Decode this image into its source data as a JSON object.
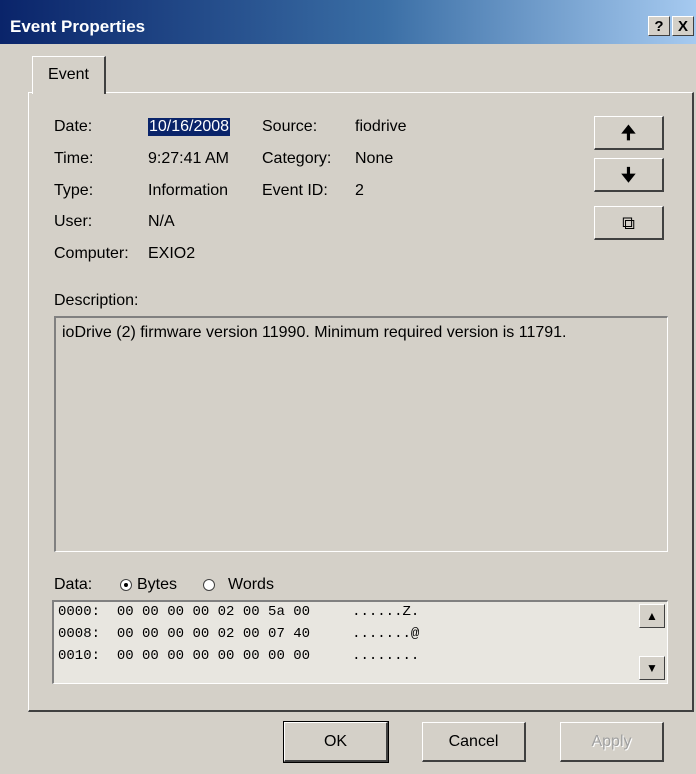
{
  "window": {
    "title": "Event Properties",
    "help_btn": "?",
    "close_btn": "X"
  },
  "tabs": [
    {
      "label": "Event"
    }
  ],
  "fields": {
    "date_label": "Date:",
    "date_value": "10/16/2008",
    "time_label": "Time:",
    "time_value": "9:27:41 AM",
    "type_label": "Type:",
    "type_value": "Information",
    "user_label": "User:",
    "user_value": "N/A",
    "computer_label": "Computer:",
    "computer_value": "EXIO2",
    "source_label": "Source:",
    "source_value": "fiodrive",
    "category_label": "Category:",
    "category_value": "None",
    "eventid_label": "Event ID:",
    "eventid_value": "2"
  },
  "nav": {
    "up_icon": "up-arrow-icon",
    "down_icon": "down-arrow-icon",
    "copy_icon": "copy-icon",
    "up": "🠉",
    "down": "🠋",
    "copy": "⧉"
  },
  "description": {
    "label": "Description:",
    "text": "ioDrive (2) firmware version 11990. Minimum required version is 11791."
  },
  "data": {
    "label": "Data:",
    "bytes_label": "Bytes",
    "words_label": "Words",
    "selected": "Bytes",
    "rows": [
      {
        "offset": "0000:",
        "hex": "00 00 00 00 02 00 5a 00",
        "ascii": "......Z."
      },
      {
        "offset": "0008:",
        "hex": "00 00 00 00 02 00 07 40",
        "ascii": ".......@"
      },
      {
        "offset": "0010:",
        "hex": "00 00 00 00 00 00 00 00",
        "ascii": "........"
      }
    ]
  },
  "buttons": {
    "ok": "OK",
    "cancel": "Cancel",
    "apply": "Apply"
  }
}
